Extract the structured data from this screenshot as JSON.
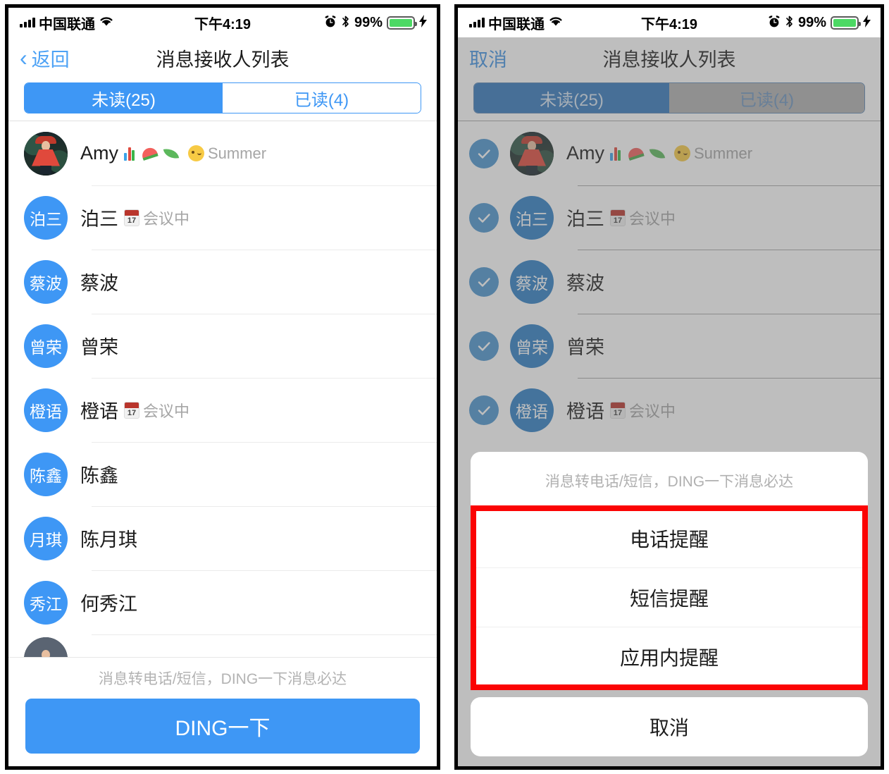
{
  "status_bar": {
    "carrier": "中国联通",
    "time": "下午4:19",
    "battery_pct": "99%",
    "icons": [
      "signal-bars-icon",
      "wifi-icon",
      "alarm-icon",
      "bluetooth-icon",
      "battery-icon",
      "charging-bolt-icon"
    ],
    "wifi_glyph": "◥",
    "alarm_glyph": "⏰",
    "bluetooth_glyph": "✲",
    "bolt_glyph": "⚡",
    "battery_color": "#4CD964"
  },
  "left_panel": {
    "nav": {
      "back_label": "返回",
      "title": "消息接收人列表"
    },
    "segmented": {
      "tabs": [
        {
          "label": "未读(25)",
          "active": true
        },
        {
          "label": "已读(4)",
          "active": false
        }
      ],
      "active_color": "#3e97f5"
    },
    "contacts": [
      {
        "name": "Amy",
        "avatar_type": "photo",
        "avatar_text": "",
        "suffix_text": "Summer",
        "emojis": [
          "bar-chart-emoji",
          "watermelon-emoji",
          "leaf-emoji",
          "winking-face-emoji"
        ],
        "status_tag": "",
        "show_calendar": false
      },
      {
        "name": "泊三",
        "avatar_type": "initials",
        "avatar_text": "泊三",
        "suffix_text": "",
        "emojis": [],
        "status_tag": "会议中",
        "show_calendar": true
      },
      {
        "name": "蔡波",
        "avatar_type": "initials",
        "avatar_text": "蔡波",
        "suffix_text": "",
        "emojis": [],
        "status_tag": "",
        "show_calendar": false
      },
      {
        "name": "曾荣",
        "avatar_type": "initials",
        "avatar_text": "曾荣",
        "suffix_text": "",
        "emojis": [],
        "status_tag": "",
        "show_calendar": false
      },
      {
        "name": "橙语",
        "avatar_type": "initials",
        "avatar_text": "橙语",
        "suffix_text": "",
        "emojis": [],
        "status_tag": "会议中",
        "show_calendar": true
      },
      {
        "name": "陈鑫",
        "avatar_type": "initials",
        "avatar_text": "陈鑫",
        "suffix_text": "",
        "emojis": [],
        "status_tag": "",
        "show_calendar": false
      },
      {
        "name": "陈月琪",
        "avatar_type": "initials",
        "avatar_text": "月琪",
        "suffix_text": "",
        "emojis": [],
        "status_tag": "",
        "show_calendar": false
      },
      {
        "name": "何秀江",
        "avatar_type": "initials",
        "avatar_text": "秀江",
        "suffix_text": "",
        "emojis": [],
        "status_tag": "",
        "show_calendar": false
      }
    ],
    "bottom": {
      "hint": "消息转电话/短信，DING一下消息必达",
      "ding_label": "DING一下",
      "ding_color": "#3e97f5"
    }
  },
  "right_panel": {
    "nav": {
      "cancel_label": "取消",
      "title": "消息接收人列表"
    },
    "segmented": {
      "tabs": [
        {
          "label": "未读(25)",
          "active": true
        },
        {
          "label": "已读(4)",
          "active": false
        }
      ]
    },
    "contacts": [
      {
        "name": "Amy",
        "avatar_type": "photo",
        "avatar_text": "",
        "suffix_text": "Summer",
        "checked": true,
        "status_tag": "",
        "show_calendar": false
      },
      {
        "name": "泊三",
        "avatar_type": "initials",
        "avatar_text": "泊三",
        "suffix_text": "",
        "checked": true,
        "status_tag": "会议中",
        "show_calendar": true
      },
      {
        "name": "蔡波",
        "avatar_type": "initials",
        "avatar_text": "蔡波",
        "suffix_text": "",
        "checked": true,
        "status_tag": "",
        "show_calendar": false
      },
      {
        "name": "曾荣",
        "avatar_type": "initials",
        "avatar_text": "曾荣",
        "suffix_text": "",
        "checked": true,
        "status_tag": "",
        "show_calendar": false
      },
      {
        "name": "橙语",
        "avatar_type": "initials",
        "avatar_text": "橙语",
        "suffix_text": "",
        "checked": true,
        "status_tag": "会议中",
        "show_calendar": true
      }
    ],
    "action_sheet": {
      "title": "消息转电话/短信，DING一下消息必达",
      "options": [
        "电话提醒",
        "短信提醒",
        "应用内提醒"
      ],
      "cancel_label": "取消",
      "highlight_color": "#fb0404"
    }
  }
}
